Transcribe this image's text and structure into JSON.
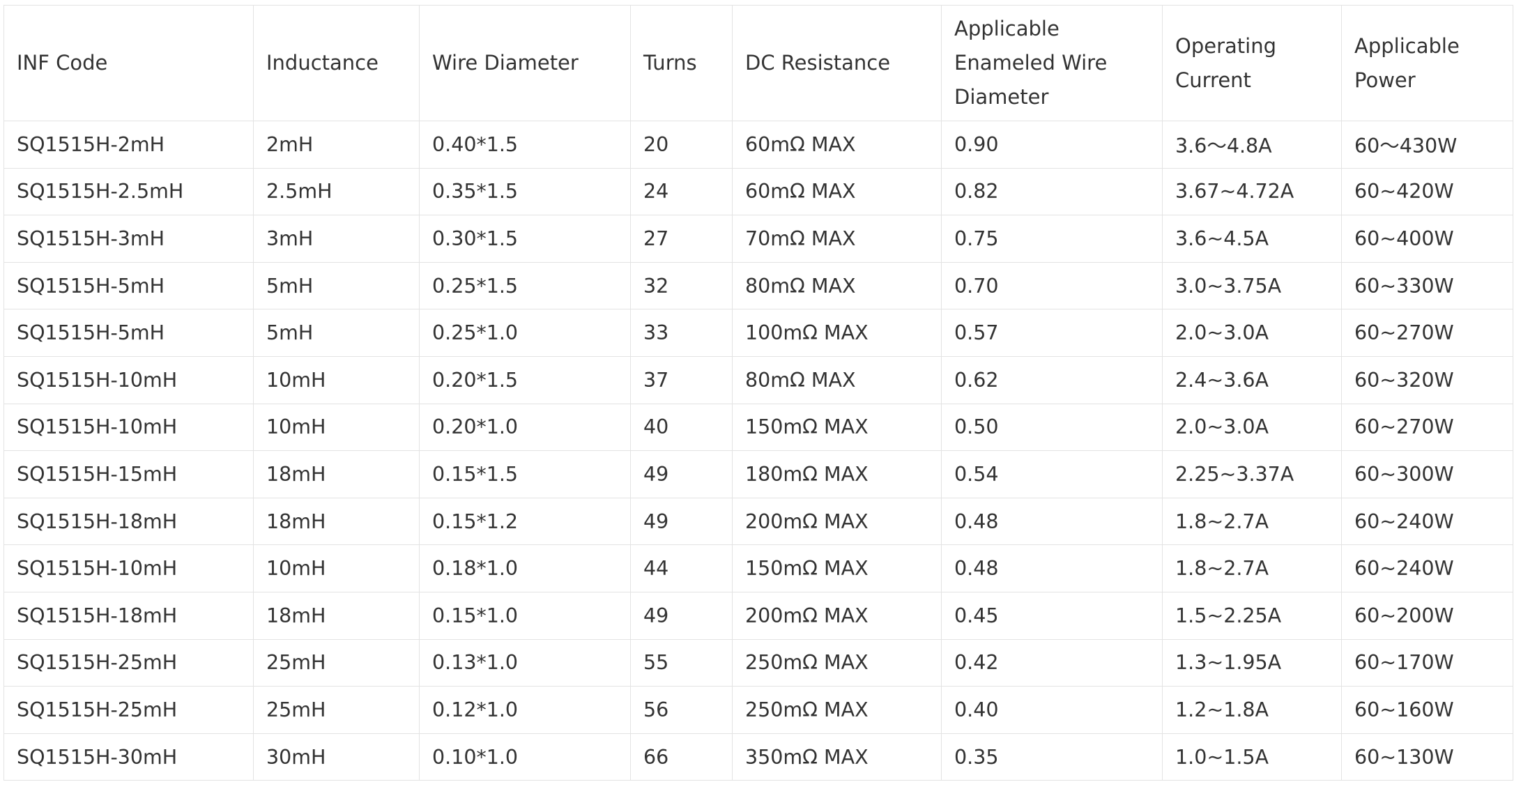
{
  "table": {
    "headers": [
      "INF Code",
      "Inductance",
      "Wire Diameter",
      "Turns",
      "DC Resistance",
      "Applicable Enameled Wire Diameter",
      "Operating Current",
      "Applicable Power"
    ],
    "rows": [
      [
        "SQ1515H-2mH",
        "2mH",
        "0.40*1.5",
        "20",
        "60mΩ MAX",
        "0.90",
        "3.6～4.8A",
        "60～430W"
      ],
      [
        "SQ1515H-2.5mH",
        "2.5mH",
        "0.35*1.5",
        "24",
        "60mΩ MAX",
        "0.82",
        "3.67~4.72A",
        "60~420W"
      ],
      [
        "SQ1515H-3mH",
        "3mH",
        "0.30*1.5",
        "27",
        "70mΩ MAX",
        "0.75",
        "3.6~4.5A",
        "60~400W"
      ],
      [
        "SQ1515H-5mH",
        "5mH",
        "0.25*1.5",
        "32",
        "80mΩ MAX",
        "0.70",
        "3.0~3.75A",
        "60~330W"
      ],
      [
        "SQ1515H-5mH",
        "5mH",
        "0.25*1.0",
        "33",
        "100mΩ MAX",
        "0.57",
        "2.0~3.0A",
        "60~270W"
      ],
      [
        "SQ1515H-10mH",
        "10mH",
        "0.20*1.5",
        "37",
        "80mΩ MAX",
        "0.62",
        "2.4~3.6A",
        "60~320W"
      ],
      [
        "SQ1515H-10mH",
        "10mH",
        "0.20*1.0",
        "40",
        "150mΩ MAX",
        "0.50",
        "2.0~3.0A",
        "60~270W"
      ],
      [
        "SQ1515H-15mH",
        "18mH",
        "0.15*1.5",
        "49",
        "180mΩ MAX",
        "0.54",
        "2.25~3.37A",
        "60~300W"
      ],
      [
        "SQ1515H-18mH",
        "18mH",
        "0.15*1.2",
        "49",
        "200mΩ MAX",
        "0.48",
        "1.8~2.7A",
        "60~240W"
      ],
      [
        "SQ1515H-10mH",
        "10mH",
        "0.18*1.0",
        "44",
        "150mΩ MAX",
        "0.48",
        "1.8~2.7A",
        "60~240W"
      ],
      [
        "SQ1515H-18mH",
        "18mH",
        "0.15*1.0",
        "49",
        "200mΩ MAX",
        "0.45",
        "1.5~2.25A",
        "60~200W"
      ],
      [
        "SQ1515H-25mH",
        "25mH",
        "0.13*1.0",
        "55",
        "250mΩ MAX",
        "0.42",
        "1.3~1.95A",
        "60~170W"
      ],
      [
        "SQ1515H-25mH",
        "25mH",
        "0.12*1.0",
        "56",
        "250mΩ MAX",
        "0.40",
        "1.2~1.8A",
        "60~160W"
      ],
      [
        "SQ1515H-30mH",
        "30mH",
        "0.10*1.0",
        "66",
        "350mΩ MAX",
        "0.35",
        "1.0~1.5A",
        "60~130W"
      ]
    ]
  }
}
